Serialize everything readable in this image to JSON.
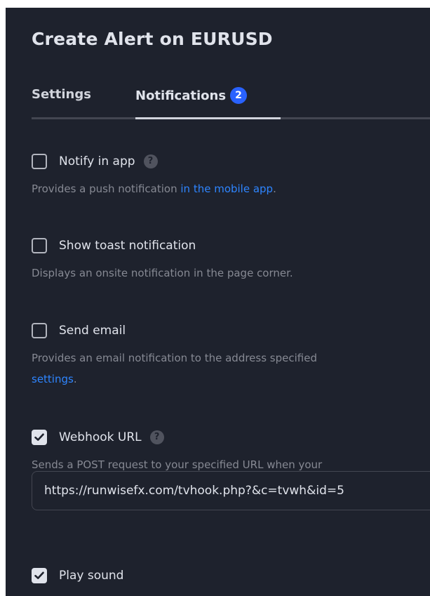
{
  "dialog": {
    "title": "Create Alert on EURUSD"
  },
  "tabs": {
    "settings_label": "Settings",
    "notifications_label": "Notifications",
    "notifications_badge": "2"
  },
  "options": {
    "notify_in_app": {
      "label": "Notify in app",
      "checked": false,
      "help_icon": "question-circle-icon",
      "desc_text": "Provides a push notification ",
      "desc_link": "in the mobile app",
      "desc_end": "."
    },
    "show_toast": {
      "label": "Show toast notification",
      "checked": false,
      "desc_text": "Displays an onsite notification in the page corner."
    },
    "send_email": {
      "label": "Send email",
      "checked": false,
      "desc_text": "Provides an email notification to the address specified",
      "desc_link": "settings",
      "desc_end": "."
    },
    "webhook_url": {
      "label": "Webhook URL",
      "checked": true,
      "help_icon": "question-circle-icon",
      "desc_text": "Sends a POST request to your specified URL when your",
      "url_value": "https://runwisefx.com/tvhook.php?&c=tvwh&id=5"
    },
    "play_sound": {
      "label": "Play sound",
      "checked": true
    }
  },
  "colors": {
    "panel_bg": "#1e222d",
    "accent_blue": "#2962ff",
    "link_blue": "#2e85ff",
    "muted_text": "#868993"
  }
}
